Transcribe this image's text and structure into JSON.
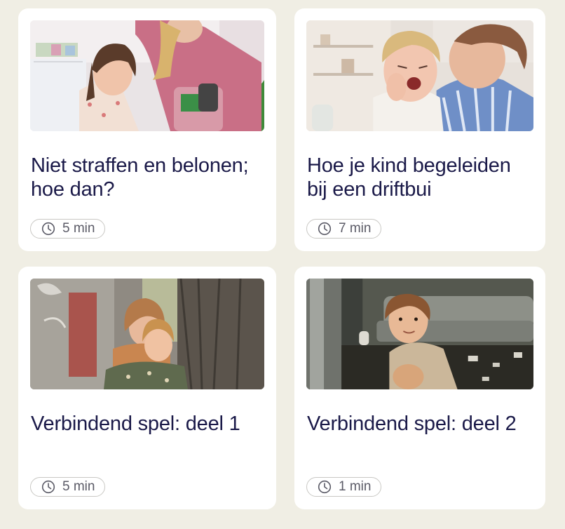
{
  "articles": [
    {
      "title": "Niet straffen en belonen; hoe dan?",
      "duration": "5 min",
      "image_icon": "photo-girl-packing-bag"
    },
    {
      "title": "Hoe je kind begeleiden bij een driftbui",
      "duration": "7 min",
      "image_icon": "photo-crying-child"
    },
    {
      "title": "Verbindend spel: deel 1",
      "duration": "5 min",
      "image_icon": "photo-children-by-tree"
    },
    {
      "title": "Verbindend spel: deel 2",
      "duration": "1 min",
      "image_icon": "photo-boy-on-floor"
    }
  ],
  "colors": {
    "background": "#f0eee4",
    "card": "#ffffff",
    "title_text": "#1a1948",
    "chip_border": "#c9c8c4",
    "chip_text": "#5a5a66"
  }
}
